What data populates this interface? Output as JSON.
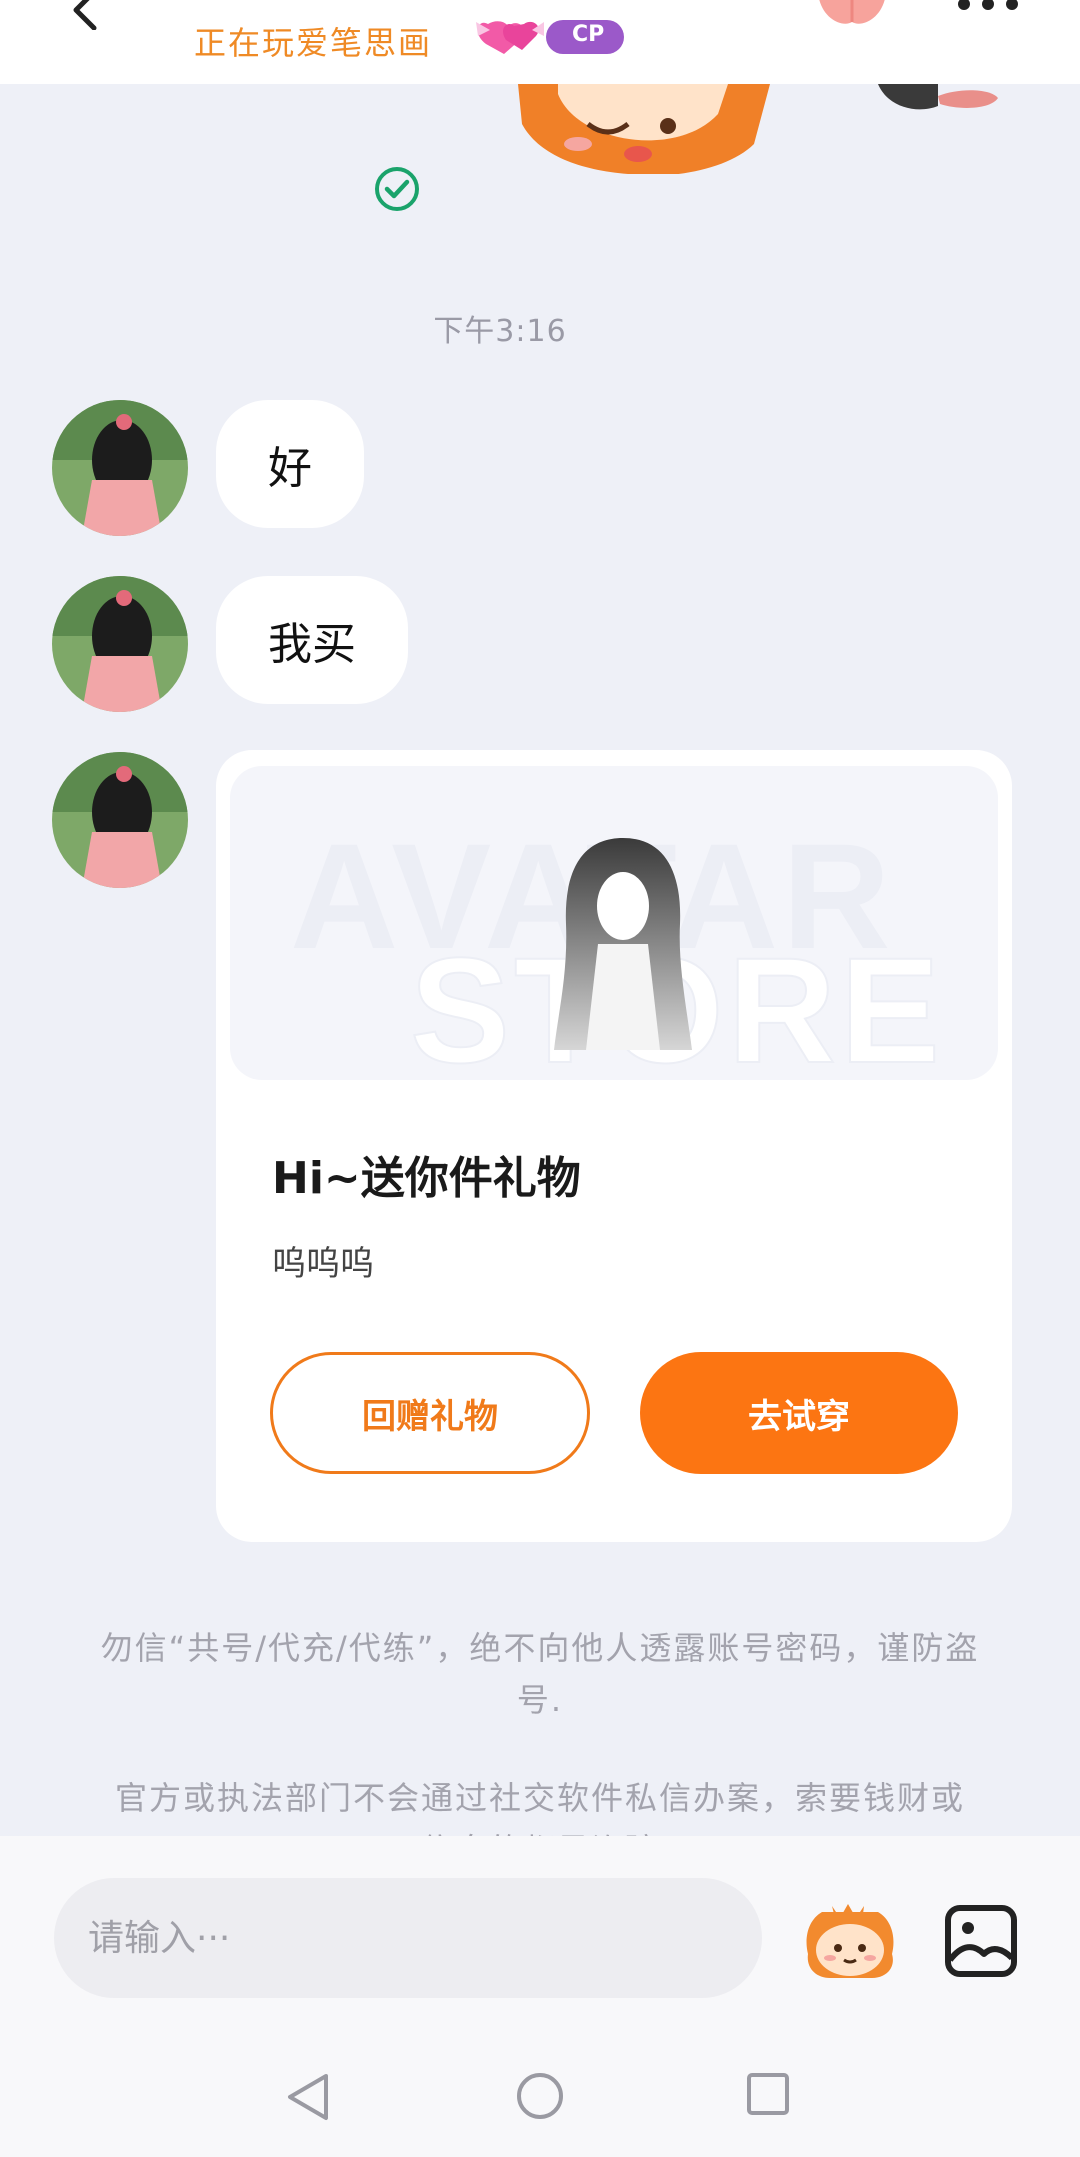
{
  "header": {
    "status": "正在玩爱笔思画",
    "cp_badge": "CP"
  },
  "chat": {
    "timestamp": "下午3:16",
    "messages": [
      {
        "text": "好"
      },
      {
        "text": "我买"
      }
    ],
    "gift_card": {
      "watermark_line1": "AVATAR",
      "watermark_line2": "STORE",
      "title": "Hi~送你件礼物",
      "subtitle": "呜呜呜",
      "return_gift_label": "回赠礼物",
      "try_on_label": "去试穿"
    },
    "notices": [
      "勿信“共号/代充/代练”，绝不向他人透露账号密码，谨防盗号.",
      "官方或执法部门不会通过社交软件私信办案，索要钱财或信息的都是诈骗"
    ]
  },
  "input": {
    "placeholder": "请输入···"
  },
  "colors": {
    "accent": "#fc7512",
    "background": "#eef0f7",
    "check": "#1aa36b"
  }
}
